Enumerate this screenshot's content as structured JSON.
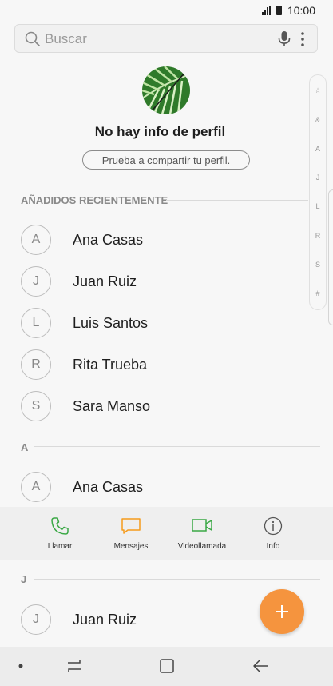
{
  "status": {
    "time": "10:00"
  },
  "search": {
    "placeholder": "Buscar"
  },
  "profile": {
    "title": "No hay info de perfil",
    "share_label": "Prueba a compartir tu perfil."
  },
  "index_bar": [
    "☆",
    "&",
    "A",
    "J",
    "L",
    "R",
    "S",
    "#"
  ],
  "recent": {
    "header": "AÑADIDOS RECIENTEMENTE",
    "items": [
      {
        "initial": "A",
        "name": "Ana Casas"
      },
      {
        "initial": "J",
        "name": "Juan Ruiz"
      },
      {
        "initial": "L",
        "name": "Luis Santos"
      },
      {
        "initial": "R",
        "name": "Rita Trueba"
      },
      {
        "initial": "S",
        "name": "Sara Manso"
      }
    ]
  },
  "section_a": {
    "header": "A",
    "items": [
      {
        "initial": "A",
        "name": "Ana Casas"
      }
    ]
  },
  "actions": [
    {
      "label": "Llamar",
      "icon": "phone-icon",
      "color": "#3aa845"
    },
    {
      "label": "Mensajes",
      "icon": "message-icon",
      "color": "#f59b1c"
    },
    {
      "label": "Videollamada",
      "icon": "video-icon",
      "color": "#3aa845"
    },
    {
      "label": "Info",
      "icon": "info-icon",
      "color": "#555555"
    }
  ],
  "section_j": {
    "header": "J",
    "items": [
      {
        "initial": "J",
        "name": "Juan Ruiz"
      }
    ]
  },
  "colors": {
    "fab": "#f5943e",
    "background": "#f7f7f7"
  }
}
